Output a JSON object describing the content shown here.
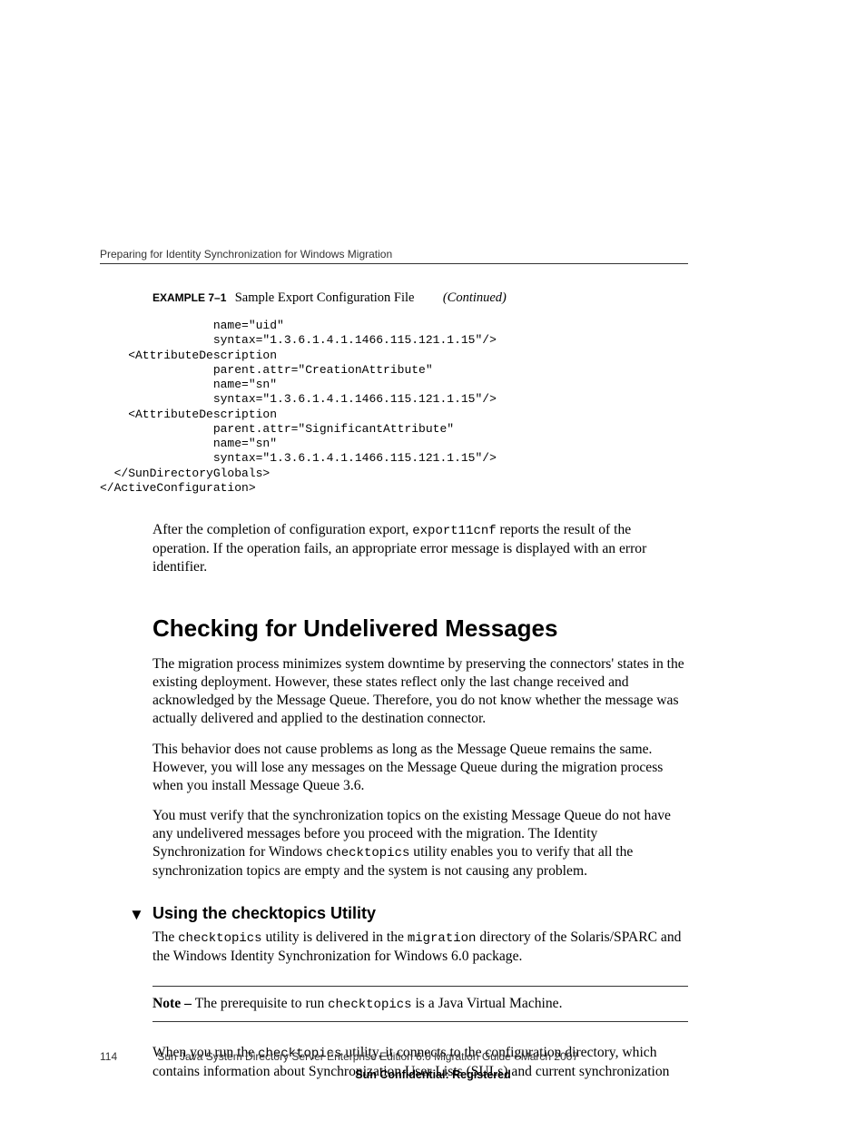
{
  "header": {
    "running_head": "Preparing for Identity Synchronization for Windows Migration"
  },
  "example": {
    "label": "EXAMPLE 7–1",
    "title": "Sample Export Configuration File",
    "continued": "(Continued)",
    "code": "                name=\"uid\"\n                syntax=\"1.3.6.1.4.1.1466.115.121.1.15\"/>\n    <AttributeDescription\n                parent.attr=\"CreationAttribute\"\n                name=\"sn\"\n                syntax=\"1.3.6.1.4.1.1466.115.121.1.15\"/>\n    <AttributeDescription\n                parent.attr=\"SignificantAttribute\"\n                name=\"sn\"\n                syntax=\"1.3.6.1.4.1.1466.115.121.1.15\"/>\n  </SunDirectoryGlobals>\n</ActiveConfiguration>"
  },
  "paras": {
    "after_export_1": "After the completion of configuration export, ",
    "after_export_code": "export11cnf",
    "after_export_2": " reports the result of the operation. If the operation fails, an appropriate error message is displayed with an error identifier.",
    "checking_heading": "Checking for Undelivered Messages",
    "checking_p1": "The migration process minimizes system downtime by preserving the connectors' states in the existing deployment. However, these states reflect only the last change received and acknowledged by the Message Queue. Therefore, you do not know whether the message was actually delivered and applied to the destination connector.",
    "checking_p2": "This behavior does not cause problems as long as the Message Queue remains the same. However, you will lose any messages on the Message Queue during the migration process when you install Message Queue 3.6.",
    "checking_p3_a": "You must verify that the synchronization topics on the existing Message Queue do not have any undelivered messages before you proceed with the migration. The Identity Synchronization for Windows ",
    "checking_p3_code": "checktopics",
    "checking_p3_b": " utility enables you to verify that all the synchronization topics are empty and the system is not causing any problem.",
    "task_heading": "Using the checktopics Utility",
    "task_p1_a": "The ",
    "task_p1_code1": "checktopics",
    "task_p1_b": " utility is delivered in the ",
    "task_p1_code2": "migration",
    "task_p1_c": " directory of the Solaris/SPARC and the Windows Identity Synchronization for Windows 6.0 package.",
    "note_label": "Note – ",
    "note_a": "The prerequisite to run ",
    "note_code": "checktopics",
    "note_b": " is a Java Virtual Machine.",
    "final_a": "When you run the ",
    "final_code": "checktopics",
    "final_b": " utility, it connects to the configuration directory, which contains information about Synchronization User Lists (SULs) and current synchronization"
  },
  "footer": {
    "page": "114",
    "title": "Sun Java System Directory Server Enterprise Edition 6.0 Migration Guide  •  March 2007",
    "confidential": "Sun Confidential: Registered"
  }
}
